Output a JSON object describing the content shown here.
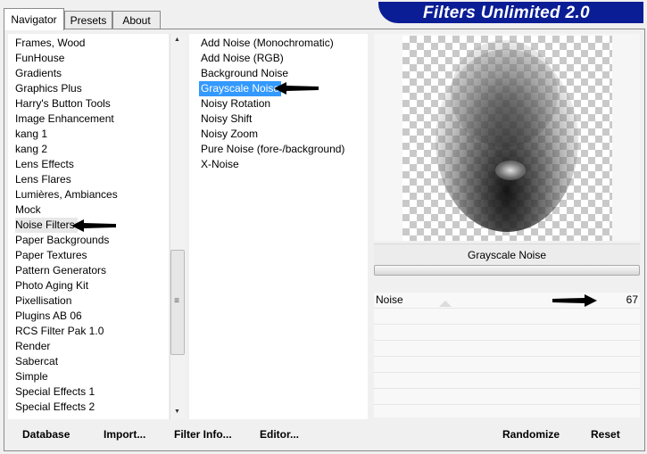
{
  "tabs": [
    {
      "label": "Navigator",
      "active": true
    },
    {
      "label": "Presets",
      "active": false
    },
    {
      "label": "About",
      "active": false
    }
  ],
  "banner": {
    "title": "Filters Unlimited 2.0"
  },
  "categories": {
    "items": [
      "Frames, Wood",
      "FunHouse",
      "Gradients",
      "Graphics Plus",
      "Harry's Button Tools",
      "Image Enhancement",
      "kang 1",
      "kang 2",
      "Lens Effects",
      "Lens Flares",
      "Lumières, Ambiances",
      "Mock",
      "Noise Filters",
      "Paper Backgrounds",
      "Paper Textures",
      "Pattern Generators",
      "Photo Aging Kit",
      "Pixellisation",
      "Plugins AB 06",
      "RCS Filter Pak 1.0",
      "Render",
      "Sabercat",
      "Simple",
      "Special Effects 1",
      "Special Effects 2"
    ],
    "selected": "Noise Filters"
  },
  "filters": {
    "items": [
      "Add Noise (Monochromatic)",
      "Add Noise (RGB)",
      "Background Noise",
      "Grayscale Noise",
      "Noisy Rotation",
      "Noisy Shift",
      "Noisy Zoom",
      "Pure Noise (fore-/background)",
      "X-Noise"
    ],
    "selected": "Grayscale Noise"
  },
  "preview": {
    "filter_name": "Grayscale Noise"
  },
  "params": [
    {
      "name": "Noise",
      "value": "67"
    }
  ],
  "buttons": {
    "database": "Database",
    "import": "Import...",
    "filter_info": "Filter Info...",
    "editor": "Editor...",
    "randomize": "Randomize",
    "reset": "Reset"
  },
  "colors": {
    "banner": "#0a1d95",
    "selection": "#3399ff"
  },
  "icons": {
    "scroll_up": "triangle-up",
    "scroll_down": "triangle-down",
    "pointer": "arrow-left"
  }
}
